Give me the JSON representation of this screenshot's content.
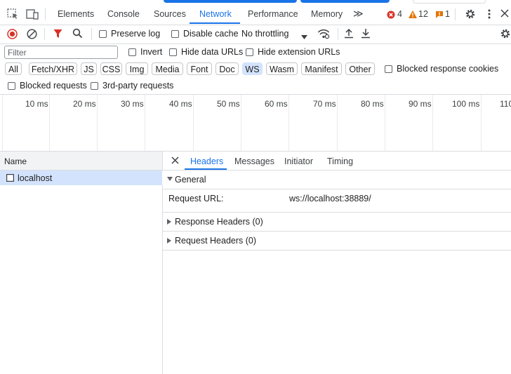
{
  "tabs": [
    {
      "label": "Elements"
    },
    {
      "label": "Console"
    },
    {
      "label": "Sources"
    },
    {
      "label": "Network"
    },
    {
      "label": "Performance"
    },
    {
      "label": "Memory"
    }
  ],
  "more_tabs": "≫",
  "counts": {
    "errors": "4",
    "warnings": "12",
    "info": "1"
  },
  "toolbar": {
    "preserve_log": "Preserve log",
    "disable_cache": "Disable cache",
    "throttling": "No throttling"
  },
  "filter": {
    "placeholder": "Filter",
    "invert": "Invert",
    "hide_data_urls": "Hide data URLs",
    "hide_extension_urls": "Hide extension URLs"
  },
  "types": [
    "All",
    "Fetch/XHR",
    "JS",
    "CSS",
    "Img",
    "Media",
    "Font",
    "Doc",
    "WS",
    "Wasm",
    "Manifest",
    "Other"
  ],
  "selected_type": "WS",
  "blocked_response_cookies": "Blocked response cookies",
  "blocked_requests": "Blocked requests",
  "third_party": "3rd-party requests",
  "timeline_ticks": [
    "10 ms",
    "20 ms",
    "30 ms",
    "40 ms",
    "50 ms",
    "60 ms",
    "70 ms",
    "80 ms",
    "90 ms",
    "100 ms",
    "110"
  ],
  "requests": {
    "header": "Name",
    "rows": [
      {
        "name": "localhost"
      }
    ]
  },
  "details": {
    "tabs": [
      "Headers",
      "Messages",
      "Initiator",
      "Timing"
    ],
    "general_title": "General",
    "request_url_label": "Request URL:",
    "request_url_value": "ws://localhost:38889/",
    "response_headers": "Response Headers (0)",
    "request_headers": "Request Headers (0)"
  },
  "colors": {
    "accent": "#1a73e8",
    "error": "#d93025",
    "warning": "#e37400",
    "selected_bg": "#d3e3fd"
  }
}
